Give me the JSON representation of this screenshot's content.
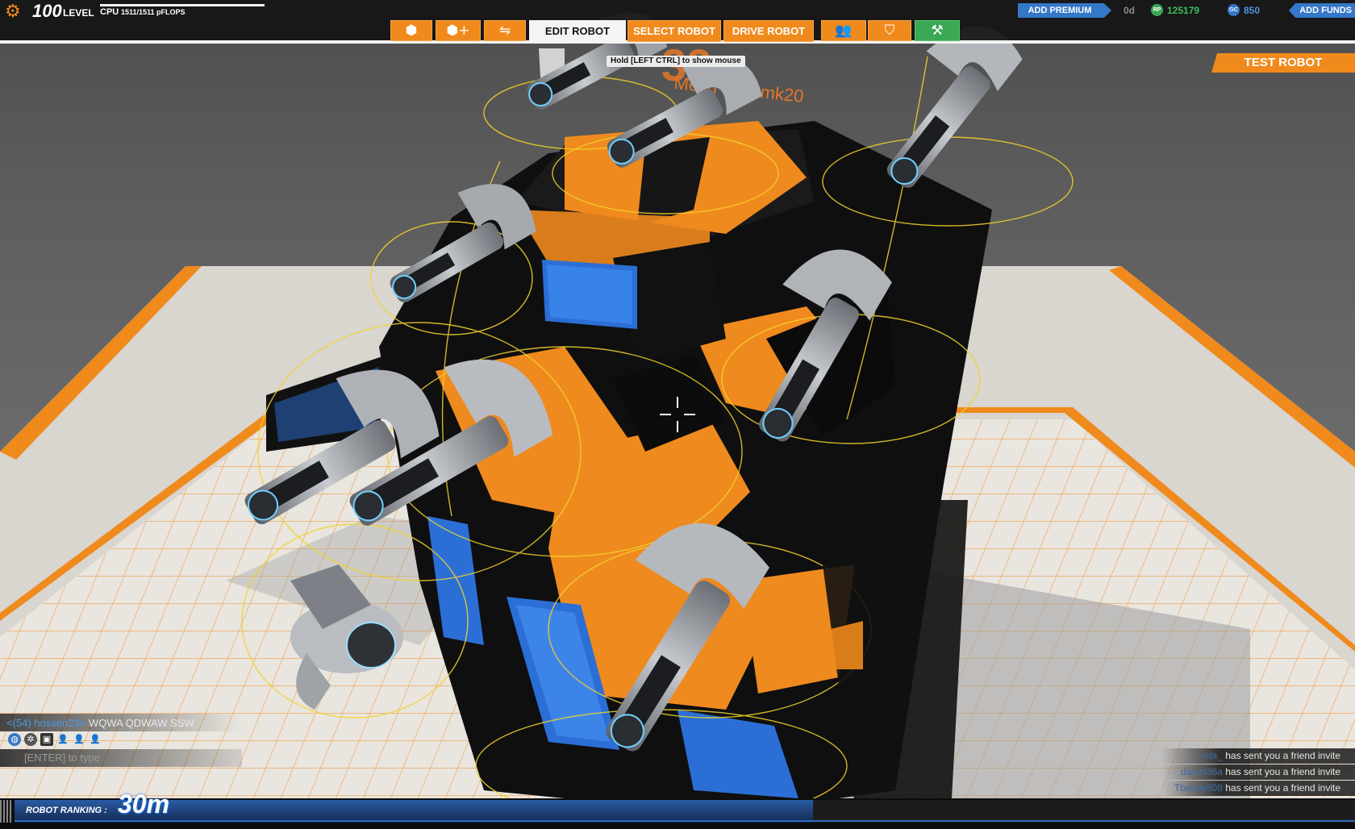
{
  "hud": {
    "level_number": "100",
    "level_word": "LEVEL",
    "cpu_label": "CPU",
    "cpu_value": "1511/1511 pFLOPS",
    "cpu_fraction": 1.0
  },
  "nav": {
    "icon_buttons_left": [
      {
        "icon": "cube-icon",
        "glyph": "⬢"
      },
      {
        "icon": "add-cube-icon",
        "glyph": "⬢+"
      },
      {
        "icon": "share-icon",
        "glyph": "⇋"
      }
    ],
    "tabs": [
      {
        "label": "EDIT ROBOT",
        "active": true
      },
      {
        "label": "SELECT ROBOT",
        "active": false
      },
      {
        "label": "DRIVE ROBOT",
        "active": false
      }
    ],
    "icon_buttons_right": [
      {
        "icon": "social-icon",
        "glyph": "👥"
      },
      {
        "icon": "shield-icon",
        "glyph": "⛉"
      },
      {
        "icon": "garage-icon",
        "glyph": "⚒"
      }
    ]
  },
  "tooltip": "Hold [LEFT CTRL] to show mouse",
  "currency": {
    "add_premium": "ADD PREMIUM",
    "premium_days": "0d",
    "rp_icon_text": "RP",
    "rp_value": "125179",
    "gc_icon_text": "GC",
    "gc_value": "850",
    "add_funds": "ADD FUNDS"
  },
  "test_robot": "TEST ROBOT",
  "robot_sign": {
    "id_text": "32",
    "name_text": "Mech ngel mk20"
  },
  "chat": {
    "user": "<(54) hossen23>",
    "message": "WQWA QDWAW SSW",
    "input_hint": "[ENTER] to type"
  },
  "notifications": [
    {
      "name": "_ista_",
      "text": "has sent you a friend invite"
    },
    {
      "name": "daniel36a",
      "text": "has sent you a friend invite"
    },
    {
      "name": "Tbeboy808",
      "text": "has sent you a friend invite"
    }
  ],
  "ranking": {
    "label": "ROBOT RANKING :",
    "value": "30m"
  },
  "colors": {
    "accent_orange": "#f08a1c",
    "accent_blue": "#3577c9",
    "rp_green": "#3fbf5d"
  }
}
